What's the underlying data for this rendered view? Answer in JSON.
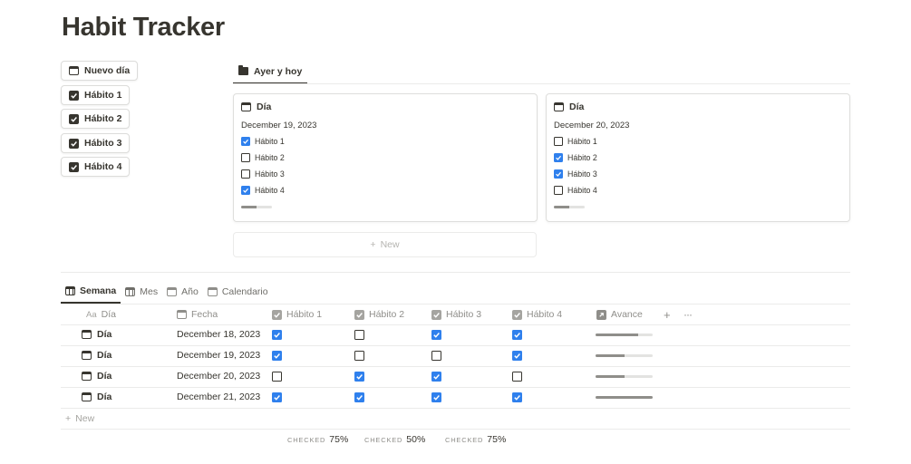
{
  "page": {
    "title": "Habit Tracker"
  },
  "buttons": [
    {
      "label": "Nuevo día",
      "icon": "calendar-icon"
    },
    {
      "label": "Hábito 1",
      "icon": "checkbox-icon"
    },
    {
      "label": "Hábito 2",
      "icon": "checkbox-icon"
    },
    {
      "label": "Hábito 3",
      "icon": "checkbox-icon"
    },
    {
      "label": "Hábito 4",
      "icon": "checkbox-icon"
    }
  ],
  "gallery": {
    "tab_label": "Ayer y hoy",
    "new_label": "New",
    "cards": [
      {
        "title": "Día",
        "date": "December 19, 2023",
        "habits": [
          {
            "label": "Hábito 1",
            "checked": true
          },
          {
            "label": "Hábito 2",
            "checked": false
          },
          {
            "label": "Hábito 3",
            "checked": false
          },
          {
            "label": "Hábito 4",
            "checked": true
          }
        ],
        "progress": 0.5
      },
      {
        "title": "Día",
        "date": "December 20, 2023",
        "habits": [
          {
            "label": "Hábito 1",
            "checked": false
          },
          {
            "label": "Hábito 2",
            "checked": true
          },
          {
            "label": "Hábito 3",
            "checked": true
          },
          {
            "label": "Hábito 4",
            "checked": false
          }
        ],
        "progress": 0.5
      }
    ]
  },
  "views": [
    {
      "label": "Semana",
      "active": true
    },
    {
      "label": "Mes",
      "active": false
    },
    {
      "label": "Año",
      "active": false
    },
    {
      "label": "Calendario",
      "active": false
    }
  ],
  "table": {
    "columns": {
      "name_prefix": "Aa",
      "name": "Día",
      "date": "Fecha",
      "h1": "Hábito 1",
      "h2": "Hábito 2",
      "h3": "Hábito 3",
      "h4": "Hábito 4",
      "progress": "Avance"
    },
    "rows": [
      {
        "name": "Día",
        "date": "December 18, 2023",
        "habits": [
          true,
          false,
          true,
          true
        ],
        "progress": 0.75
      },
      {
        "name": "Día",
        "date": "December 19, 2023",
        "habits": [
          true,
          false,
          false,
          true
        ],
        "progress": 0.5
      },
      {
        "name": "Día",
        "date": "December 20, 2023",
        "habits": [
          false,
          true,
          true,
          false
        ],
        "progress": 0.5
      },
      {
        "name": "Día",
        "date": "December 21, 2023",
        "habits": [
          true,
          true,
          true,
          true
        ],
        "progress": 1.0
      }
    ],
    "new_label": "New",
    "calculations": [
      {
        "label": "CHECKED",
        "value": "75%"
      },
      {
        "label": "CHECKED",
        "value": "50%"
      },
      {
        "label": "CHECKED",
        "value": "75%"
      }
    ]
  },
  "colors": {
    "checked": "#2f80ed",
    "text": "#37352f",
    "muted": "#8f8e8a"
  }
}
